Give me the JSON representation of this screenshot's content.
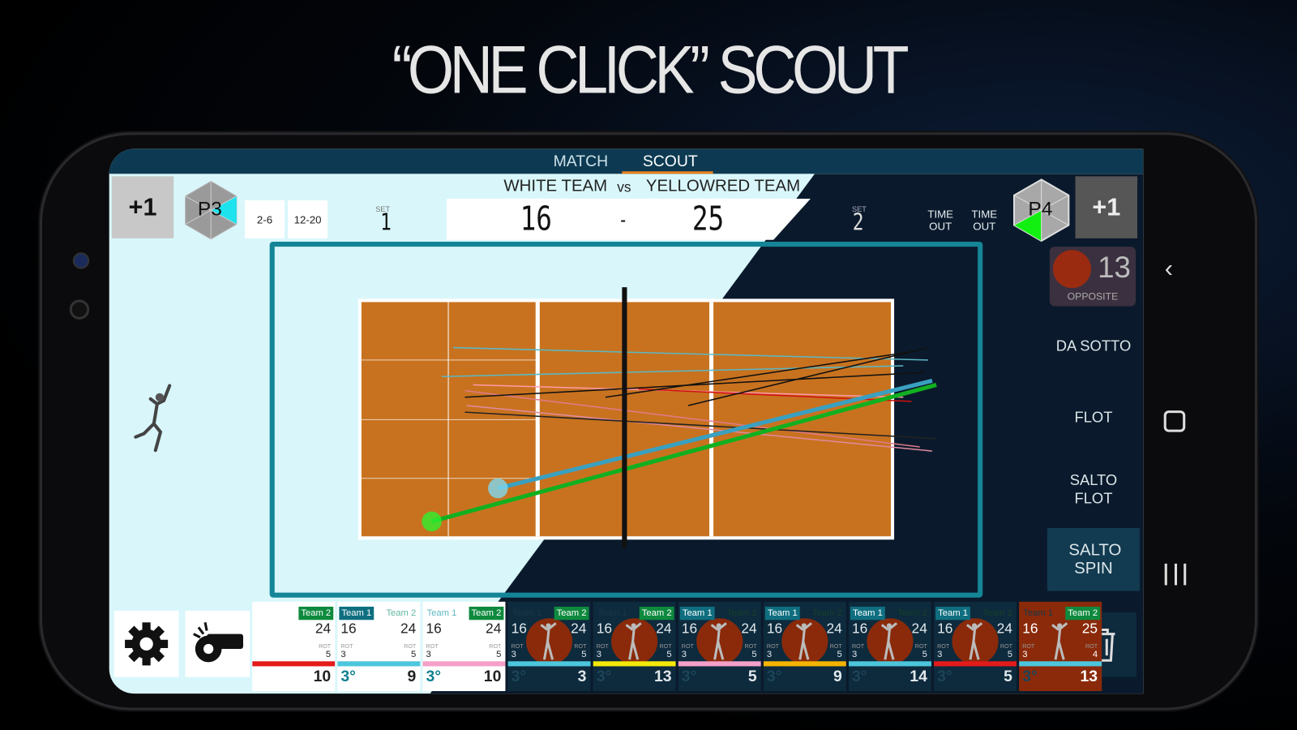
{
  "headline": "“ONE CLICK” SCOUT",
  "tabs": [
    {
      "label": "MATCH",
      "active": false
    },
    {
      "label": "SCOUT",
      "active": true
    }
  ],
  "header": {
    "home_team": "WHITE TEAM",
    "vs": "vs",
    "away_team": "YELLOWRED TEAM",
    "home_score": "16",
    "separator": "-",
    "away_score": "25",
    "left": {
      "plus_label": "+1",
      "position": "P3",
      "box1": "2-6",
      "box2": "12-20",
      "set_label": "SET",
      "set_value": "1"
    },
    "right": {
      "set_label": "SET",
      "set_value": "2",
      "timeout1": "TIME OUT",
      "timeout2": "TIME OUT",
      "position": "P4",
      "plus_label": "+1"
    }
  },
  "player": {
    "number": "13",
    "role": "OPPOSITE"
  },
  "serve_types": [
    "DA SOTTO",
    "FLOT",
    "SALTO FLOT",
    "SALTO SPIN"
  ],
  "selected_serve": "SALTO SPIN",
  "colors": {
    "accent": "#e8821e",
    "court": "#c8721f",
    "frame": "#148597",
    "dark": "#0a1a2c",
    "light": "#d9f7fb",
    "team1": "#0f6f80",
    "team2": "#0e8a3e"
  },
  "icons": {
    "settings": "gear-icon",
    "whistle": "whistle-icon",
    "delete": "trash-icon",
    "back": "chevron-left-icon",
    "home": "square-icon",
    "recents": "recents-icon"
  },
  "rally_cards": [
    {
      "team1": "",
      "team2": "Team 2",
      "active": "team2",
      "score1": "",
      "score2": "24",
      "rot_label": "ROT",
      "rot1": "",
      "rot2": "5",
      "bar": "#e41b1b",
      "deg": "",
      "number": "10",
      "style": "light"
    },
    {
      "team1": "Team 1",
      "team2": "Team 2",
      "active": "team1",
      "score1": "16",
      "score2": "24",
      "rot_label": "ROT",
      "rot1": "3",
      "rot2": "5",
      "bar": "#4cc6dc",
      "deg": "3°",
      "number": "9",
      "style": "light"
    },
    {
      "team1": "Team 1",
      "team2": "Team 2",
      "active": "team2",
      "score1": "16",
      "score2": "24",
      "rot_label": "ROT",
      "rot1": "3",
      "rot2": "5",
      "bar": "#f5a0c8",
      "deg": "3°",
      "number": "10",
      "style": "light"
    },
    {
      "team1": "Team 1",
      "team2": "Team 2",
      "active": "team2",
      "score1": "16",
      "score2": "24",
      "rot_label": "ROT",
      "rot1": "3",
      "rot2": "5",
      "bar": "#4cc6dc",
      "deg": "3°",
      "number": "3",
      "style": "dark"
    },
    {
      "team1": "Team 1",
      "team2": "Team 2",
      "active": "team2",
      "score1": "16",
      "score2": "24",
      "rot_label": "ROT",
      "rot1": "3",
      "rot2": "5",
      "bar": "#f5e90a",
      "deg": "3°",
      "number": "13",
      "style": "dark"
    },
    {
      "team1": "Team 1",
      "team2": "Team 2",
      "active": "team1",
      "score1": "16",
      "score2": "24",
      "rot_label": "ROT",
      "rot1": "3",
      "rot2": "5",
      "bar": "#f5a0c8",
      "deg": "3°",
      "number": "5",
      "style": "dark"
    },
    {
      "team1": "Team 1",
      "team2": "Team 2",
      "active": "team1",
      "score1": "16",
      "score2": "24",
      "rot_label": "ROT",
      "rot1": "3",
      "rot2": "5",
      "bar": "#f5b400",
      "deg": "3°",
      "number": "9",
      "style": "dark"
    },
    {
      "team1": "Team 1",
      "team2": "Team 2",
      "active": "team1",
      "score1": "16",
      "score2": "24",
      "rot_label": "ROT",
      "rot1": "3",
      "rot2": "5",
      "bar": "#4cc6dc",
      "deg": "3°",
      "number": "14",
      "style": "dark"
    },
    {
      "team1": "Team 1",
      "team2": "Team 2",
      "active": "team1",
      "score1": "16",
      "score2": "24",
      "rot_label": "ROT",
      "rot1": "3",
      "rot2": "5",
      "bar": "#e41b1b",
      "deg": "3°",
      "number": "5",
      "style": "dark"
    },
    {
      "team1": "Team 1",
      "team2": "Team 2",
      "active": "team2",
      "score1": "16",
      "score2": "25",
      "rot_label": "ROT",
      "rot1": "3",
      "rot2": "4",
      "bar": "#4cc6dc",
      "deg": "3°",
      "number": "13",
      "style": "red"
    }
  ]
}
